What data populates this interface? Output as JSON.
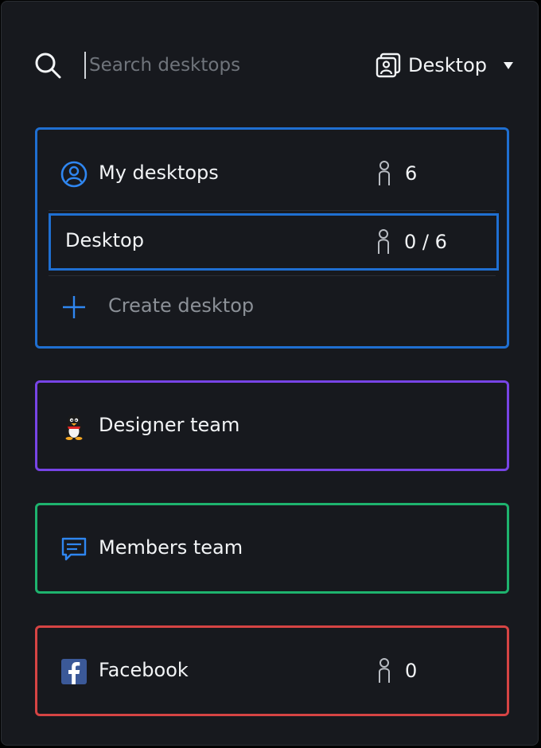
{
  "search": {
    "placeholder": "Search desktops",
    "value": ""
  },
  "mode_select": {
    "label": "Desktop",
    "icon": "desktop-card-icon"
  },
  "groups": {
    "my_desktops": {
      "label": "My desktops",
      "count": "6",
      "icon": "user-circle-icon",
      "color": "#1f6fd1",
      "items": [
        {
          "label": "Desktop",
          "count": "0 / 6"
        }
      ],
      "create_label": "Create desktop"
    },
    "designer_team": {
      "label": "Designer team",
      "icon": "penguin-icon",
      "color": "#7744e6"
    },
    "members_team": {
      "label": "Members team",
      "icon": "chat-icon",
      "color": "#1eb36e"
    },
    "facebook": {
      "label": "Facebook",
      "count": "0",
      "icon": "facebook-icon",
      "color": "#d64444"
    }
  }
}
